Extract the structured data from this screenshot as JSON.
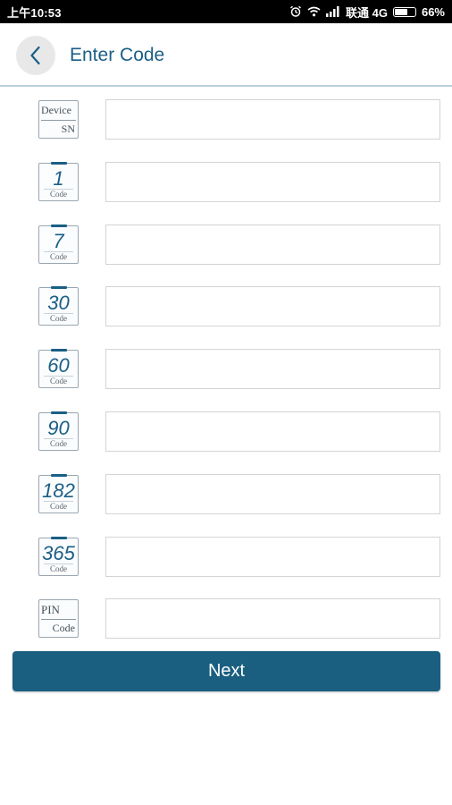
{
  "status_bar": {
    "time": "上午10:53",
    "carrier": "联通 4G",
    "battery": "66%",
    "battery_level": 0.66
  },
  "header": {
    "title": "Enter Code",
    "back_icon": "chevron-left-icon"
  },
  "rows": [
    {
      "icon_type": "box",
      "top_label": "Device",
      "bottom_label": "SN",
      "value": "",
      "placeholder": ""
    },
    {
      "icon_type": "days",
      "number": "1",
      "sub_label": "Code",
      "value": "",
      "placeholder": ""
    },
    {
      "icon_type": "days",
      "number": "7",
      "sub_label": "Code",
      "value": "",
      "placeholder": ""
    },
    {
      "icon_type": "days",
      "number": "30",
      "sub_label": "Code",
      "value": "",
      "placeholder": ""
    },
    {
      "icon_type": "days",
      "number": "60",
      "sub_label": "Code",
      "value": "",
      "placeholder": ""
    },
    {
      "icon_type": "days",
      "number": "90",
      "sub_label": "Code",
      "value": "",
      "placeholder": ""
    },
    {
      "icon_type": "days",
      "number": "182",
      "sub_label": "Code",
      "value": "",
      "placeholder": ""
    },
    {
      "icon_type": "days",
      "number": "365",
      "sub_label": "Code",
      "value": "",
      "placeholder": ""
    },
    {
      "icon_type": "box",
      "top_label": "PIN",
      "bottom_label": "Code",
      "value": "",
      "placeholder": ""
    }
  ],
  "next_button": {
    "label": "Next"
  },
  "colors": {
    "accent": "#1b5f80",
    "title": "#1a5f86",
    "divider": "#b9cfdc"
  }
}
